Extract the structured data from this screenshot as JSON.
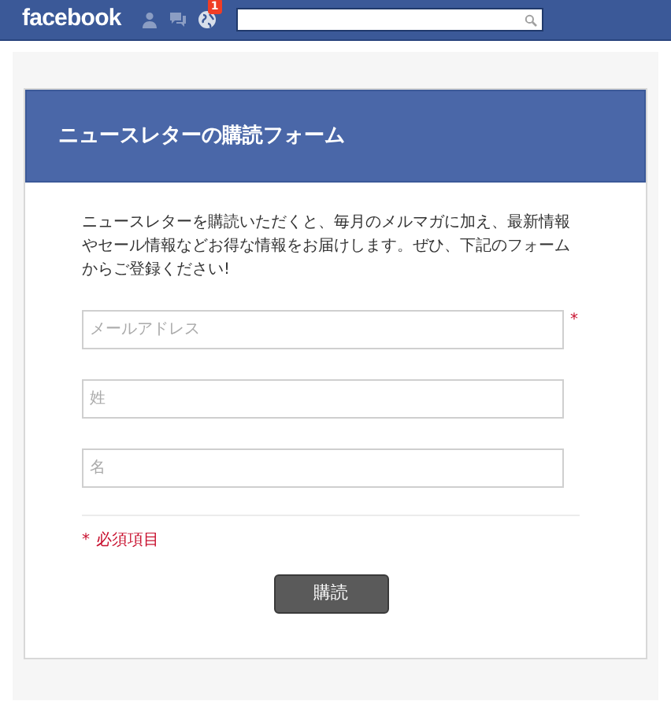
{
  "topbar": {
    "logo": "facebook",
    "notifications_badge": "1"
  },
  "form": {
    "title": "ニュースレターの購読フォーム",
    "intro": "ニュースレターを購読いただくと、毎月のメルマガに加え、最新情報やセール情報などお得な情報をお届けします。ぜひ、下記のフォームからご登録ください!",
    "fields": [
      {
        "placeholder": "メールアドレス",
        "required_mark": "*"
      },
      {
        "placeholder": "姓"
      },
      {
        "placeholder": "名"
      }
    ],
    "required_note": {
      "mark": "*",
      "text": "必須項目"
    },
    "submit": "購読"
  }
}
